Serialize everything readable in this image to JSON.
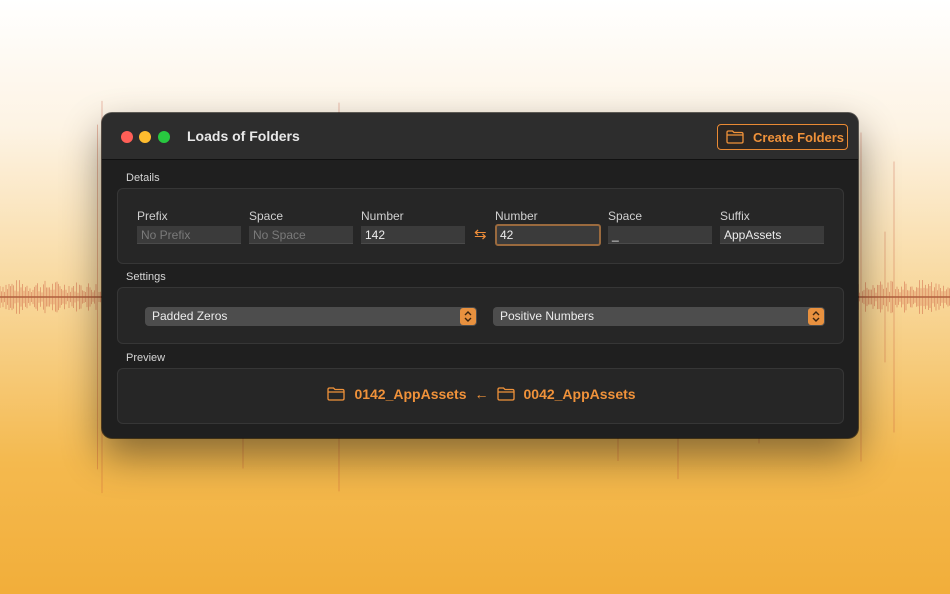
{
  "window": {
    "title": "Loads of Folders",
    "create_button_label": "Create Folders"
  },
  "details": {
    "section_label": "Details",
    "prefix": {
      "label": "Prefix",
      "placeholder": "No Prefix",
      "value": ""
    },
    "space_left": {
      "label": "Space",
      "placeholder": "No Space",
      "value": ""
    },
    "number_left": {
      "label": "Number",
      "value": "142"
    },
    "swap_icon": "⇆",
    "number_right": {
      "label": "Number",
      "value": "42"
    },
    "space_right": {
      "label": "Space",
      "value": "_"
    },
    "suffix": {
      "label": "Suffix",
      "value": "AppAssets"
    }
  },
  "settings": {
    "section_label": "Settings",
    "padding_select": "Padded Zeros",
    "sign_select": "Positive Numbers"
  },
  "preview": {
    "section_label": "Preview",
    "new_name": "0142_AppAssets",
    "arrow": "←",
    "old_name": "0042_AppAssets"
  },
  "colors": {
    "accent": "#f0923a",
    "background_top": "#ffffff",
    "background_bottom": "#f2ae3a",
    "window_bg": "#1f1f1f"
  },
  "icons": [
    "folder-icon",
    "swap-icon",
    "left-arrow-icon",
    "stepper-icon"
  ]
}
